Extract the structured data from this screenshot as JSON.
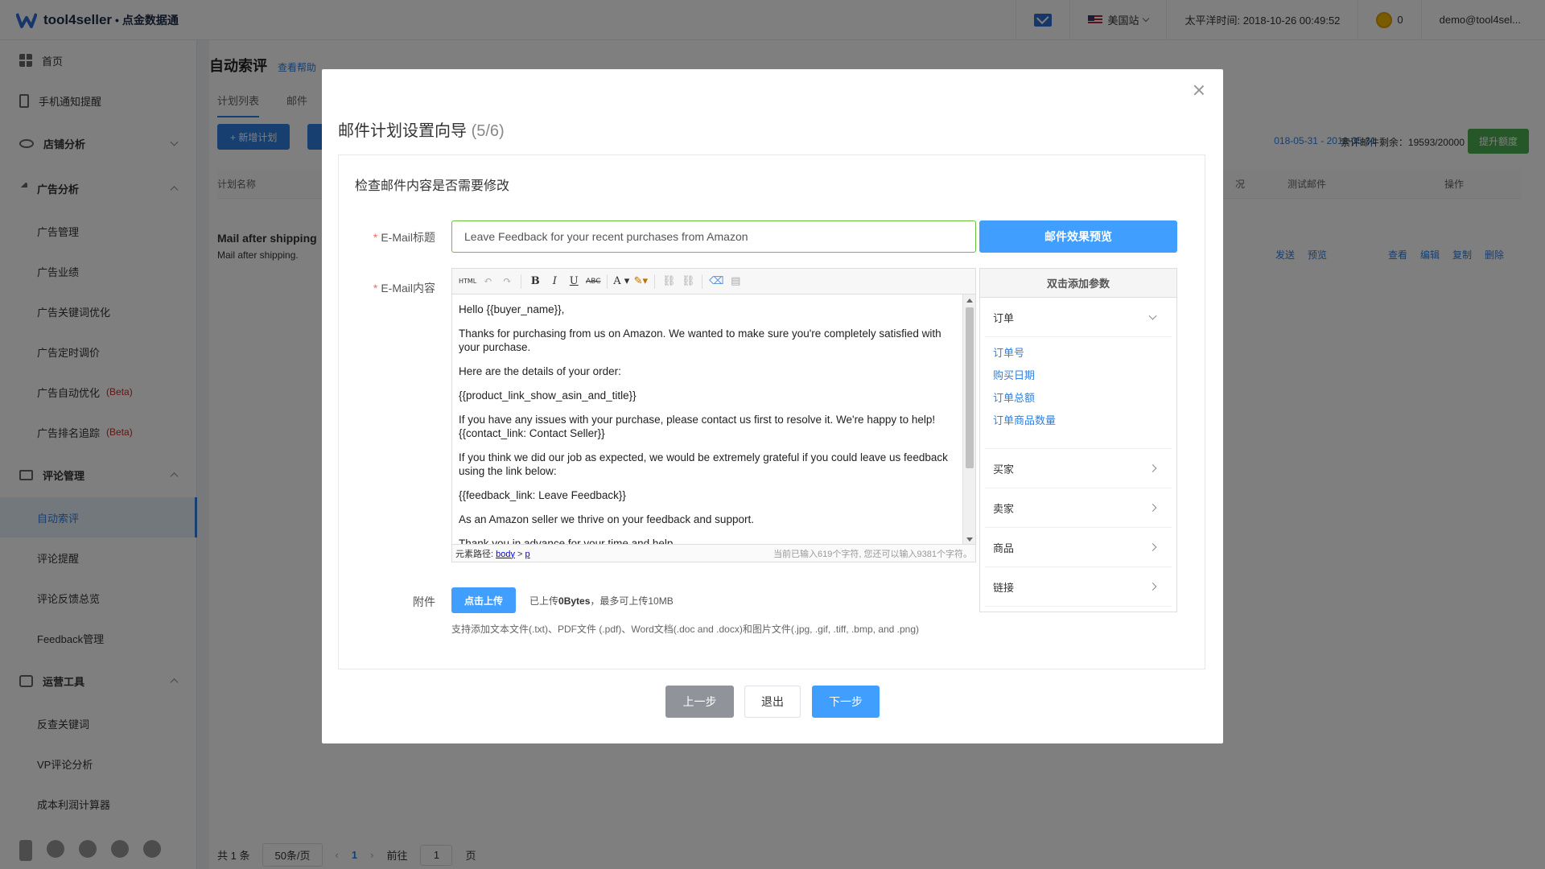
{
  "header": {
    "brand": "tool4seller",
    "brand_sub": "• 点金数据通",
    "marketplace": "美国站",
    "time": "太平洋时间: 2018-10-26 00:49:52",
    "coins": "0",
    "user": "demo@tool4sel..."
  },
  "sidebar": {
    "items": [
      {
        "label": "首页"
      },
      {
        "label": "手机通知提醒"
      },
      {
        "label": "店铺分析"
      },
      {
        "label": "广告分析"
      },
      {
        "label": "广告管理"
      },
      {
        "label": "广告业绩"
      },
      {
        "label": "广告关键词优化"
      },
      {
        "label": "广告定时调价"
      },
      {
        "label": "广告自动优化",
        "badge": "(Beta)"
      },
      {
        "label": "广告排名追踪",
        "badge": "(Beta)"
      },
      {
        "label": "评论管理"
      },
      {
        "label": "自动索评"
      },
      {
        "label": "评论提醒"
      },
      {
        "label": "评论反馈总览"
      },
      {
        "label": "Feedback管理"
      },
      {
        "label": "运营工具"
      },
      {
        "label": "反查关键词"
      },
      {
        "label": "VP评论分析"
      },
      {
        "label": "成本利润计算器"
      }
    ]
  },
  "main": {
    "title": "自动索评",
    "help": "查看帮助",
    "tabs": [
      "计划列表",
      "邮件"
    ],
    "new_plan": "+ 新增计划",
    "date_range": "018-05-31 - 2019-05-31",
    "quota": "索评邮件剩余：19593/20000",
    "upgrade": "提升额度",
    "columns": [
      "计划名称",
      "况",
      "测试邮件",
      "操作"
    ],
    "row": {
      "name": "Mail after shipping",
      "desc": "Mail after shipping.",
      "test_actions": [
        "发送",
        "预览"
      ],
      "actions": [
        "查看",
        "编辑",
        "复制",
        "删除"
      ]
    },
    "pager": {
      "total": "共 1 条",
      "page_size": "50条/页",
      "current": "1",
      "goto_label": "前往",
      "goto_value": "1",
      "page_suffix": "页"
    }
  },
  "modal": {
    "title": "邮件计划设置向导",
    "step": "(5/6)",
    "section_title": "检查邮件内容是否需要修改",
    "subject_label": "E-Mail标题",
    "subject_value": "Leave Feedback for your recent purchases from Amazon",
    "preview_button": "邮件效果预览",
    "content_label": "E-Mail内容",
    "body_paragraphs": [
      "Hello {{buyer_name}},",
      "Thanks for purchasing from us on Amazon. We wanted to make sure you're completely satisfied with your purchase.",
      "Here are the details of your order:",
      "{{product_link_show_asin_and_title}}",
      "If you have any issues with your purchase, please contact us first to resolve it. We're happy to help! {{contact_link: Contact Seller}}",
      "If you think we did our job as expected, we would be extremely grateful if you could leave us feedback using the link below:",
      "{{feedback_link: Leave Feedback}}",
      "As an Amazon seller we thrive on your feedback and support.",
      "Thank you in advance for your time and help."
    ],
    "status_path_label": "元素路径:",
    "status_path": [
      "body",
      "p"
    ],
    "status_count": "当前已输入619个字符, 您还可以输入9381个字符。",
    "params": {
      "title": "双击添加参数",
      "order_group": "订单",
      "order_items": [
        "订单号",
        "购买日期",
        "订单总额",
        "订单商品数量"
      ],
      "groups": [
        "买家",
        "卖家",
        "商品",
        "链接"
      ]
    },
    "attach_label": "附件",
    "attach_button": "点击上传",
    "attach_info_prefix": "已上传",
    "attach_size": "0Bytes",
    "attach_info_suffix": "，最多可上传10MB",
    "attach_note": "支持添加文本文件(.txt)、PDF文件 (.pdf)、Word文档(.doc and .docx)和图片文件(.jpg, .gif, .tiff, .bmp, and .png)",
    "prev_button": "上一步",
    "exit_button": "退出",
    "next_button": "下一步"
  }
}
